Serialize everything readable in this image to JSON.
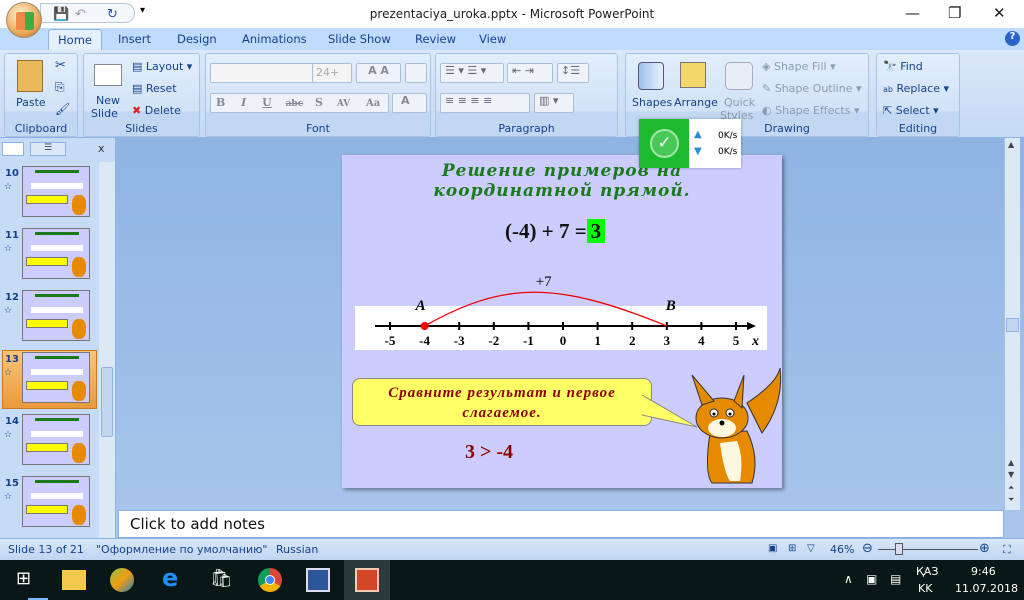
{
  "window": {
    "title": "prezentaciya_uroka.pptx - Microsoft PowerPoint"
  },
  "tabs": [
    "Home",
    "Insert",
    "Design",
    "Animations",
    "Slide Show",
    "Review",
    "View"
  ],
  "ribbon": {
    "clipboard": {
      "label": "Clipboard",
      "paste": "Paste"
    },
    "slides": {
      "label": "Slides",
      "new_slide_1": "New",
      "new_slide_2": "Slide",
      "layout": "Layout",
      "reset": "Reset",
      "delete": "Delete"
    },
    "font": {
      "label": "Font",
      "size": "24+",
      "bold": "B",
      "italic": "I",
      "underline": "U",
      "strike": "abc",
      "shadow": "S",
      "spacing": "AV",
      "case": "Aa",
      "color": "A"
    },
    "paragraph": {
      "label": "Paragraph"
    },
    "drawing": {
      "label": "Drawing",
      "shapes": "Shapes",
      "arrange": "Arrange",
      "quick_styles_1": "Quick",
      "quick_styles_2": "Styles",
      "shape_fill": "Shape Fill",
      "shape_outline": "Shape Outline",
      "shape_effects": "Shape Effects"
    },
    "editing": {
      "label": "Editing",
      "find": "Find",
      "replace": "Replace",
      "select": "Select"
    }
  },
  "net_popup": {
    "up": "0K/s",
    "down": "0K/s",
    "accent": "#1db92e"
  },
  "thumbnails": [
    {
      "num": "10"
    },
    {
      "num": "11"
    },
    {
      "num": "12"
    },
    {
      "num": "13",
      "selected": true
    },
    {
      "num": "14"
    },
    {
      "num": "15"
    }
  ],
  "slide": {
    "title_1": "Решение примеров на",
    "title_2": "координатной прямой.",
    "equation": "(-4) + 7 =",
    "answer": "3",
    "arc_label": "+7",
    "point_a": "A",
    "point_b": "B",
    "axis_label": "x",
    "ticks": [
      "-5",
      "-4",
      "-3",
      "-2",
      "-1",
      "0",
      "1",
      "2",
      "3",
      "4",
      "5"
    ],
    "start": -4,
    "end": 3,
    "callout": "Сравните результат и первое слагаемое.",
    "comparison": "3 > -4"
  },
  "notes": {
    "placeholder": "Click to add notes"
  },
  "status": {
    "slide": "Slide 13 of 21",
    "theme": "\"Оформление по умолчанию\"",
    "language": "Russian",
    "zoom": "46%"
  },
  "taskbar": {
    "lang_1": "ҚАЗ",
    "lang_2": "KK",
    "time": "9:46",
    "date": "11.07.2018"
  }
}
